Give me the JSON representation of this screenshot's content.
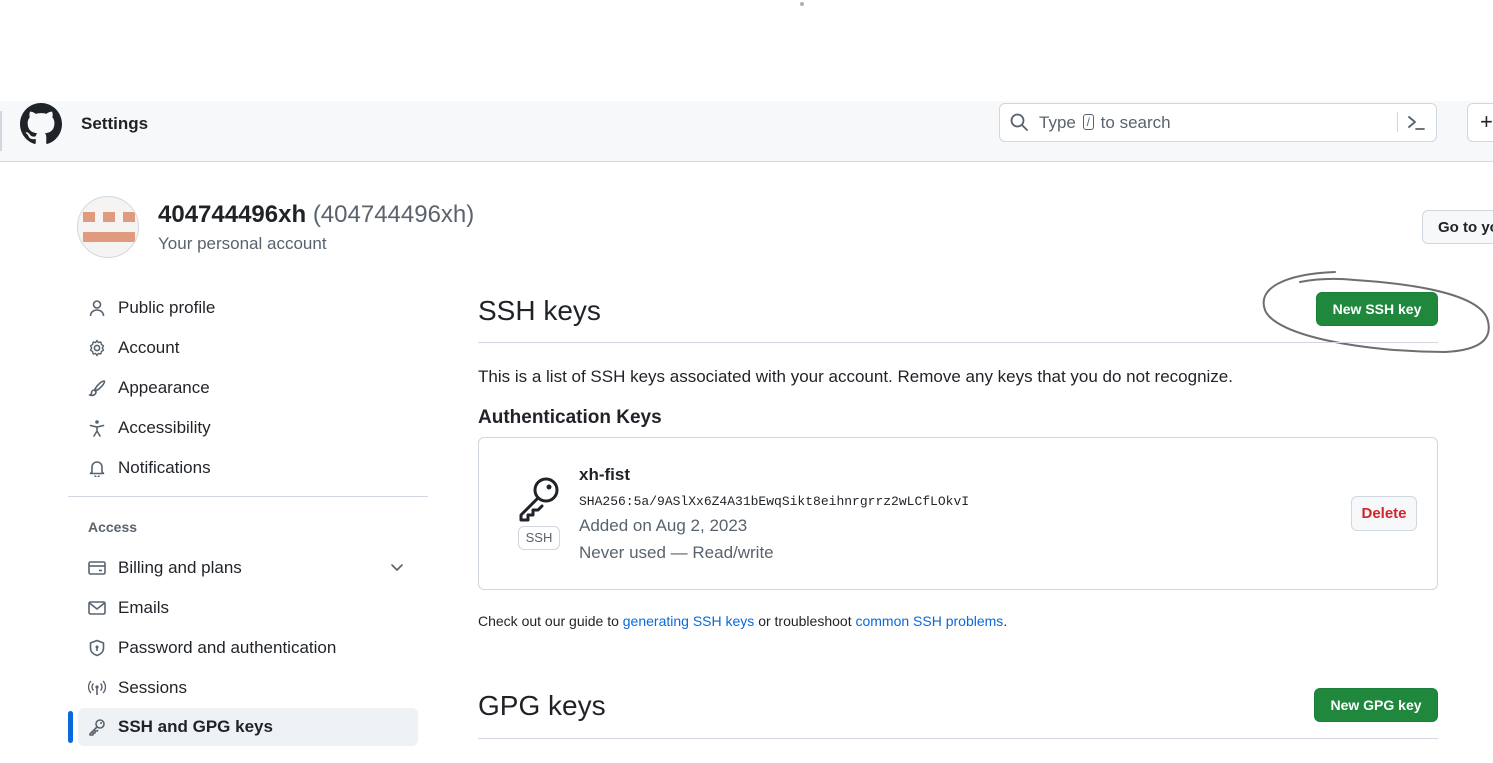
{
  "header": {
    "title": "Settings",
    "search": {
      "prefix": "Type",
      "key": "/",
      "suffix": "to search"
    },
    "plus_label": "+"
  },
  "account": {
    "name": "404744496xh",
    "login": "(404744496xh)",
    "subtitle": "Your personal account",
    "goto_label": "Go to yo"
  },
  "sidebar": {
    "items": [
      {
        "label": "Public profile",
        "icon": "person-icon"
      },
      {
        "label": "Account",
        "icon": "gear-icon"
      },
      {
        "label": "Appearance",
        "icon": "paintbrush-icon"
      },
      {
        "label": "Accessibility",
        "icon": "accessibility-icon"
      },
      {
        "label": "Notifications",
        "icon": "bell-icon"
      }
    ],
    "access_heading": "Access",
    "access_items": [
      {
        "label": "Billing and plans",
        "icon": "credit-card-icon"
      },
      {
        "label": "Emails",
        "icon": "mail-icon"
      },
      {
        "label": "Password and authentication",
        "icon": "shield-lock-icon"
      },
      {
        "label": "Sessions",
        "icon": "broadcast-icon"
      },
      {
        "label": "SSH and GPG keys",
        "icon": "key-icon",
        "active": true
      }
    ]
  },
  "main": {
    "ssh_title": "SSH keys",
    "new_ssh_label": "New SSH key",
    "intro": "This is a list of SSH keys associated with your account. Remove any keys that you do not recognize.",
    "auth_heading": "Authentication Keys",
    "key": {
      "badge": "SSH",
      "title": "xh-fist",
      "fingerprint": "SHA256:5a/9ASlXx6Z4A31bEwqSikt8eihnrgrrz2wLCfLOkvI",
      "added": "Added on Aug 2, 2023",
      "usage": "Never used — Read/write",
      "delete_label": "Delete"
    },
    "guide": {
      "prefix": "Check out our guide to",
      "link1": "generating SSH keys",
      "middle": "or troubleshoot",
      "link2": "common SSH problems",
      "suffix": "."
    },
    "gpg_title": "GPG keys",
    "new_gpg_label": "New GPG key"
  },
  "colors": {
    "primary_button": "#1f883d",
    "link": "#0969da",
    "danger": "#d1242f",
    "active_indicator": "#0969da"
  }
}
